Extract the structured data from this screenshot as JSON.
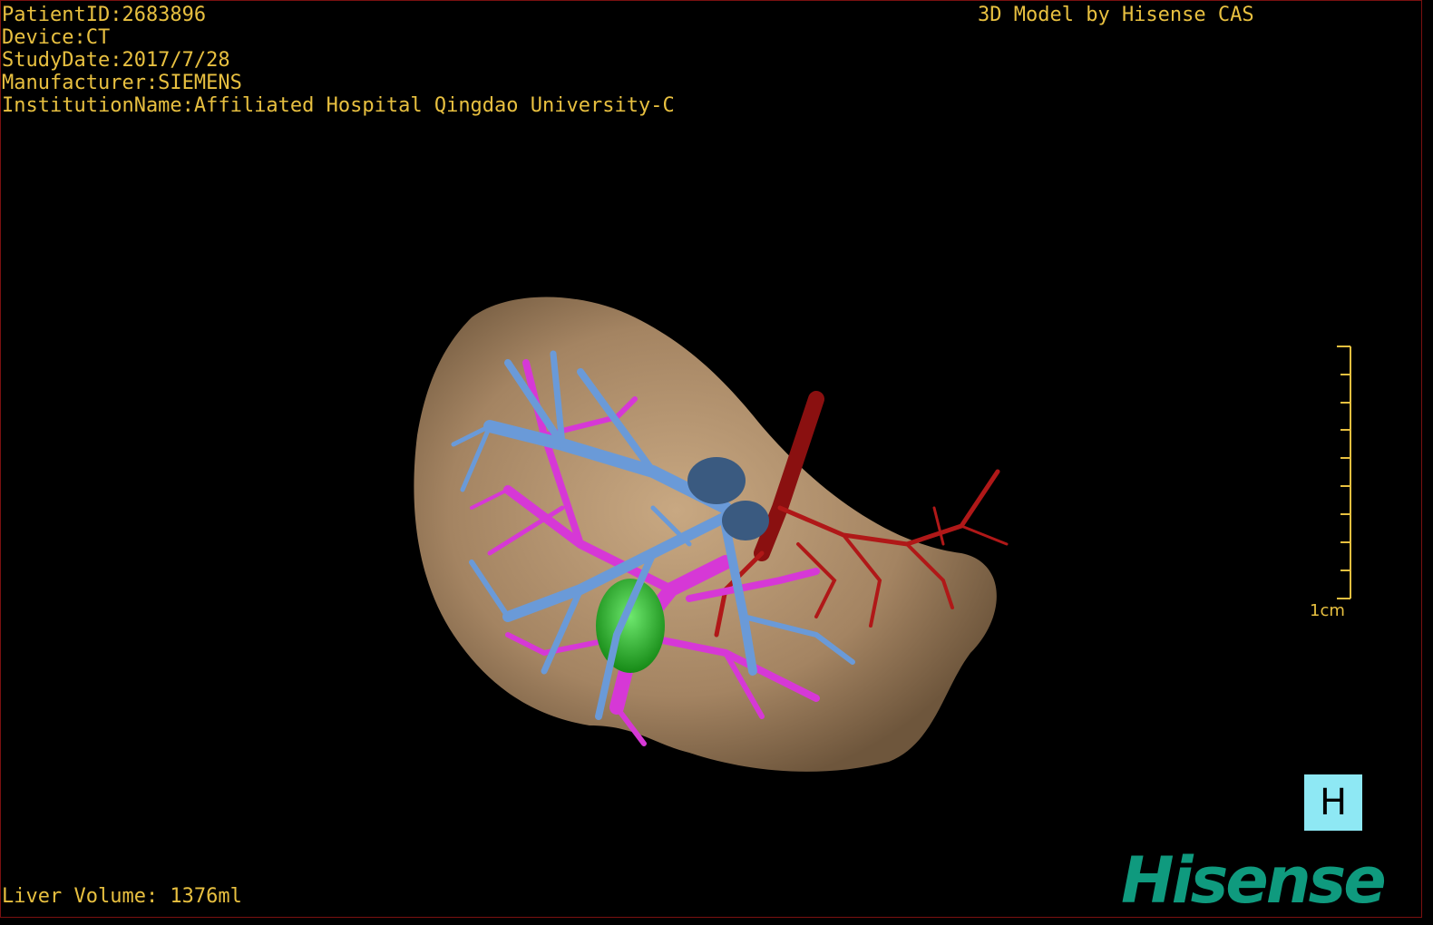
{
  "header": {
    "patient_id": "PatientID:2683896",
    "device": "Device:CT",
    "study_date": "StudyDate:2017/7/28",
    "manufacturer": "Manufacturer:SIEMENS",
    "institution": "InstitutionName:Affiliated Hospital Qingdao University-C"
  },
  "top_right": {
    "model_credit": "3D Model by Hisense CAS"
  },
  "footer": {
    "liver_volume": "Liver Volume: 1376ml"
  },
  "scale_bar": {
    "label": "1cm"
  },
  "orientation": {
    "label": "H"
  },
  "brand": {
    "logo_text": "Hisense"
  },
  "colors": {
    "text": "#e8c040",
    "liver": "#a08060",
    "portal_vein": "#d638d6",
    "hepatic_vein": "#6a9ad8",
    "artery": "#b01818",
    "gallbladder": "#2ab42a",
    "orientation_box": "#8ee8f4",
    "brand": "#0f9a7e"
  }
}
